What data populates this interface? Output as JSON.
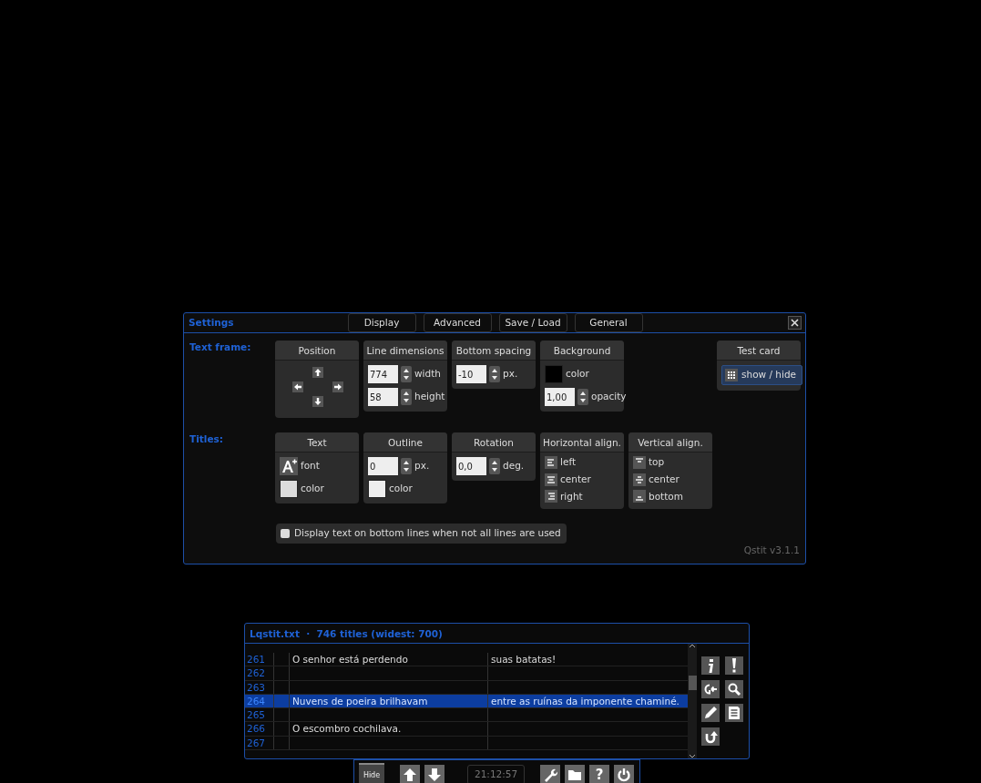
{
  "settings": {
    "title": "Settings",
    "tabs": [
      {
        "label": "Display",
        "selected": false
      },
      {
        "label": "Advanced",
        "selected": false
      },
      {
        "label": "Save / Load",
        "selected": false
      },
      {
        "label": "General",
        "selected": false
      }
    ],
    "sections": [
      {
        "label": "Text frame:",
        "groups": [
          {
            "title": "Position",
            "rows": [
              {
                "kind": "arrows"
              }
            ]
          },
          {
            "title": "Line dimensions",
            "rows": [
              {
                "kind": "spinner",
                "value": "774",
                "label": "width"
              },
              {
                "kind": "spinner",
                "value": "58",
                "label": "height"
              }
            ]
          },
          {
            "title": "Bottom spacing",
            "rows": [
              {
                "kind": "spinner",
                "value": "-10",
                "label": "px."
              }
            ]
          },
          {
            "title": "Background",
            "rows": [
              {
                "kind": "swatch",
                "color": "#000000",
                "label": "color"
              },
              {
                "kind": "spinner",
                "value": "1,00",
                "label": "opacity"
              }
            ]
          },
          {
            "title": "Test card",
            "rows": [
              {
                "kind": "grid-button",
                "label": "show / hide"
              }
            ]
          }
        ]
      },
      {
        "label": "Titles:",
        "groups": [
          {
            "title": "Text",
            "rows": [
              {
                "kind": "font",
                "label": "font"
              },
              {
                "kind": "swatch",
                "color": "#dcdcdc",
                "label": "color"
              }
            ]
          },
          {
            "title": "Outline",
            "rows": [
              {
                "kind": "spinner",
                "value": "0",
                "label": "px."
              },
              {
                "kind": "swatch",
                "color": "#eeeeee",
                "label": "color"
              }
            ]
          },
          {
            "title": "Rotation",
            "rows": [
              {
                "kind": "spinner",
                "value": "0,0",
                "label": "deg."
              }
            ]
          },
          {
            "title": "Horizontal align.",
            "rows": [
              {
                "kind": "h-left",
                "label": "left"
              },
              {
                "kind": "h-center",
                "label": "center"
              },
              {
                "kind": "h-right",
                "label": "right"
              }
            ]
          },
          {
            "title": "Vertical align.",
            "rows": [
              {
                "kind": "v-top",
                "label": "top"
              },
              {
                "kind": "v-center",
                "label": "center"
              },
              {
                "kind": "v-bottom",
                "label": "bottom"
              }
            ]
          }
        ]
      }
    ],
    "checkbox": {
      "label": "Display text on bottom lines when not all lines are used",
      "checked": false
    },
    "version": "Qstit v3.1.1"
  },
  "list": {
    "title": "Lqstit.txt  ·  746 titles (widest: 700)",
    "rows": [
      {
        "number": "261",
        "text": "O senhor está perdendo",
        "text_2": "suas batatas!",
        "selected": false
      },
      {
        "number": "262",
        "text": "",
        "text_2": "",
        "selected": false
      },
      {
        "number": "263",
        "text": "",
        "text_2": "",
        "selected": false
      },
      {
        "number": "264",
        "text": "Nuvens de poeira brilhavam",
        "text_2": "entre as ruínas da imponente chaminé.",
        "selected": true
      },
      {
        "number": "265",
        "text": "",
        "text_2": "",
        "selected": false
      },
      {
        "number": "266",
        "text": "O escombro cochilava.",
        "text_2": "",
        "selected": false
      },
      {
        "number": "267",
        "text": "",
        "text_2": "",
        "selected": false
      }
    ],
    "tools": [
      {
        "kind": "info"
      },
      {
        "kind": "warning"
      },
      {
        "kind": "goto"
      },
      {
        "kind": "search"
      },
      {
        "kind": "edit"
      },
      {
        "kind": "save"
      },
      {
        "kind": "undo"
      }
    ]
  },
  "toolbar": {
    "hide": "Hide",
    "time": "21:12:57",
    "help": "?"
  }
}
